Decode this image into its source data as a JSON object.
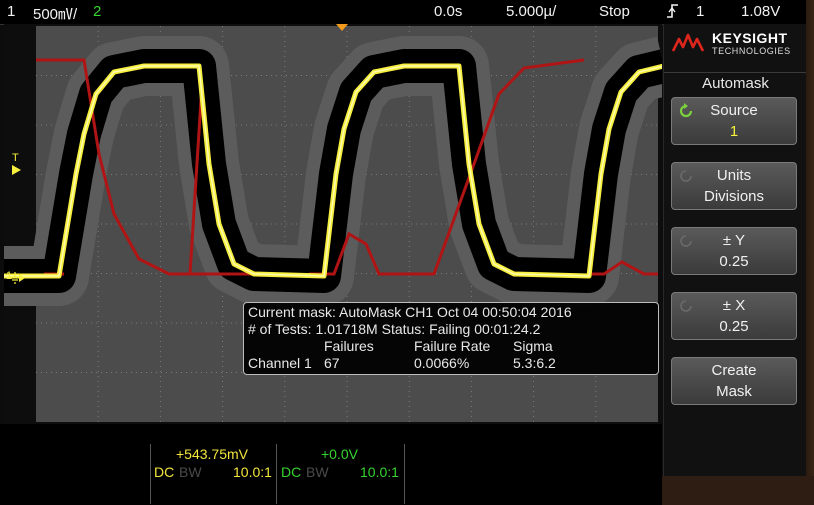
{
  "topbar": {
    "ch1_num": "1",
    "ch1_scale": "500㎷/",
    "ch2_num": "2",
    "time_offset": "0.0s",
    "time_scale": "5.000µ/",
    "run_state": "Stop",
    "trigger_icon": "rising-edge-trigger-icon",
    "trigger_source": "1",
    "trigger_level": "1.08V"
  },
  "display": {
    "trigger_marker": "T",
    "ch1_ground_marker": "1",
    "colors": {
      "ch1_waveform": "#f6ef3d",
      "mask": "#000000",
      "mask_violation": "#b01414",
      "mask_region_fill": "#5c5c5c"
    }
  },
  "mask_info": {
    "line1": "Current mask: AutoMask CH1 Oct 04 00:50:04 2016",
    "line2": "# of Tests: 1.01718M  Status: Failing  00:01:24.2",
    "headers": {
      "failures": "Failures",
      "failure_rate": "Failure Rate",
      "sigma": "Sigma"
    },
    "row": {
      "channel": "Channel 1",
      "failures": "67",
      "failure_rate": "0.0066%",
      "sigma": "5.3:6.2"
    }
  },
  "bottom": {
    "ch1": {
      "offset": "+543.75mV",
      "coupling": "DC",
      "bw": "BW",
      "probe": "10.0:1"
    },
    "ch2": {
      "offset": "+0.0V",
      "coupling": "DC",
      "bw": "BW",
      "probe": "10.0:1"
    }
  },
  "softpanel": {
    "brand": "KEYSIGHT",
    "brand_sub": "TECHNOLOGIES",
    "menu_title": "Automask",
    "keys": [
      {
        "label": "Source",
        "value": "1",
        "knob": "entry-knob-icon"
      },
      {
        "label": "Units",
        "value": "Divisions",
        "knob": "entry-knob-icon"
      },
      {
        "label": "± Y",
        "value": "0.25",
        "knob": "entry-knob-icon"
      },
      {
        "label": "± X",
        "value": "0.25",
        "knob": "entry-knob-icon"
      },
      {
        "label": "Create",
        "value": "Mask"
      }
    ]
  }
}
